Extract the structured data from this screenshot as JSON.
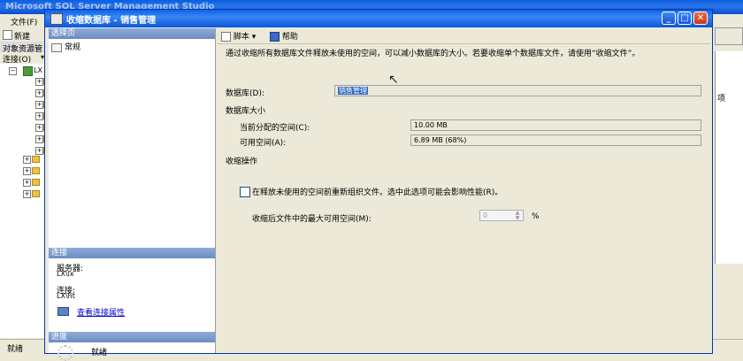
{
  "app": {
    "title": "Microsoft SQL Server Management Studio",
    "menu": [
      "文件(F)"
    ],
    "toolbar_new": "新建",
    "object_explorer": {
      "header": "对象资源管",
      "connect_label": "连接(O)",
      "root_node": "LX"
    },
    "right_panel_text": "项",
    "status": "就绪"
  },
  "dialog": {
    "title": "收缩数据库 - 销售管理",
    "select_page_header": "选择页",
    "pages": [
      {
        "label": "常规",
        "icon": "page-icon"
      }
    ],
    "connection": {
      "header": "连接",
      "server_label": "服务器:",
      "server_value": "LX\\lx",
      "connection_label": "连接:",
      "connection_value": "LX\\ht",
      "view_properties_link": "查看连接属性"
    },
    "progress": {
      "header": "进度",
      "status": "就绪"
    },
    "toolbar": {
      "script_label": "脚本",
      "help_label": "帮助"
    },
    "description": "通过收缩所有数据库文件释放未使用的空间，可以减小数据库的大小。若要收缩单个数据库文件，请使用“收缩文件”。",
    "database_label": "数据库(D):",
    "database_value": "销售管理",
    "size_section_label": "数据库大小",
    "allocated_label": "当前分配的空间(C):",
    "allocated_value": "10.00 MB",
    "free_label": "可用空间(A):",
    "free_value": "6.89 MB (68%)",
    "shrink_section_label": "收缩操作",
    "reorganize_checkbox_label": "在释放未使用的空间前重新组织文件。选中此选项可能会影响性能(R)。",
    "reorganize_checked": false,
    "max_free_label": "收缩后文件中的最大可用空间(M):",
    "max_free_value": "0",
    "percent_sign": "%"
  }
}
